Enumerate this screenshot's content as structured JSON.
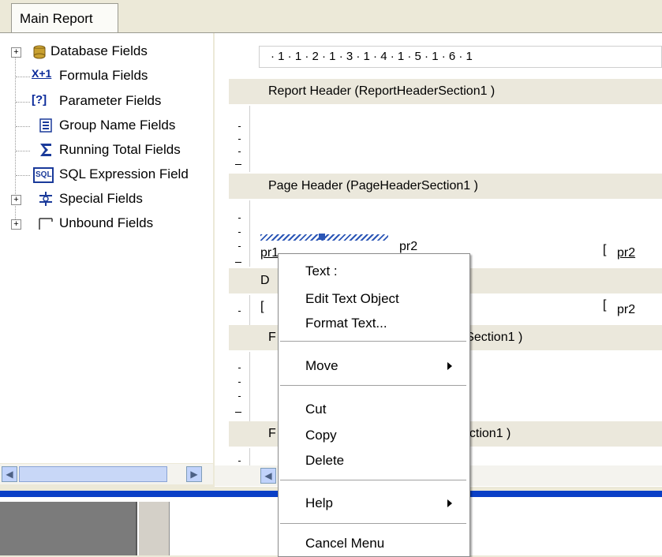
{
  "tab": {
    "label": "Main Report"
  },
  "tree": {
    "items": [
      {
        "label": "Database Fields",
        "icon": "database-icon",
        "expandable": true
      },
      {
        "label": "Formula Fields",
        "icon": "formula-icon",
        "expandable": false
      },
      {
        "label": "Parameter Fields",
        "icon": "parameter-icon",
        "expandable": false
      },
      {
        "label": "Group Name Fields",
        "icon": "group-name-icon",
        "expandable": false
      },
      {
        "label": "Running Total Fields",
        "icon": "sigma-icon",
        "expandable": false
      },
      {
        "label": "SQL Expression Field",
        "icon": "sql-icon",
        "expandable": false
      },
      {
        "label": "Special Fields",
        "icon": "special-fields-icon",
        "expandable": true
      },
      {
        "label": "Unbound Fields",
        "icon": "unbound-fields-icon",
        "expandable": true
      }
    ],
    "formula_glyph": "X+1",
    "param_glyph": "[?]",
    "sql_glyph": "SQL"
  },
  "ruler": {
    "text": "· 1 · 1 · 2 · 1 · 3 · 1 · 4 · 1 · 5 · 1 · 6 · 1"
  },
  "sections": {
    "report_header": "Report Header  (ReportHeaderSection1 )",
    "page_header": "Page Header  (PageHeaderSection1 )",
    "section3_visible": "erSection1 )",
    "section3_prefix": "F",
    "section4_visible": "ection1 )",
    "section4_prefix": "F",
    "details_prefix": "D"
  },
  "fields": {
    "pr1": "pr1",
    "pr2_a": "pr2",
    "pr2_b": "pr2",
    "pr2_c": "pr2"
  },
  "context_menu": {
    "items": [
      {
        "label": "Text :",
        "submenu": false
      },
      {
        "label": "Edit Text Object",
        "submenu": false
      },
      {
        "label": "Format Text...",
        "submenu": false
      },
      {
        "label": "Move",
        "submenu": true
      },
      {
        "label": "Cut",
        "submenu": false
      },
      {
        "label": "Copy",
        "submenu": false
      },
      {
        "label": "Delete",
        "submenu": false
      },
      {
        "label": "Help",
        "submenu": true
      },
      {
        "label": "Cancel Menu",
        "submenu": false
      }
    ]
  },
  "colors": {
    "accent_blue": "#0a3fc6",
    "section_bar": "#ebe8dc",
    "window_bg": "#ece9d8"
  }
}
